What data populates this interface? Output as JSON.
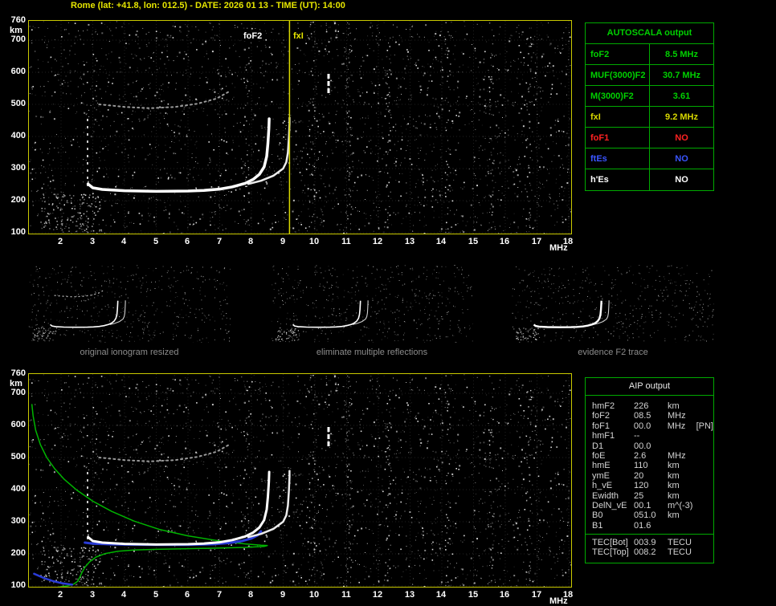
{
  "title": "Rome (lat: +41.8, lon: 012.5) - DATE: 2026 01 13 - TIME (UT): 14:00",
  "colors": {
    "title_yellow": "#e6e600",
    "plot_border": "#c9c900",
    "table_border": "#00aa00",
    "table_green": "#00d000",
    "value_yellow": "#d8d800",
    "value_red": "#ff2222",
    "value_blue": "#3a55ff",
    "value_white": "#ffffff",
    "profile_green": "#00b400",
    "fit_blue": "#2a3cd8",
    "caption_gray": "#8c8c8c"
  },
  "plots": {
    "x_unit": "MHz",
    "y_unit": "km",
    "x_ticks": [
      2,
      3,
      4,
      5,
      6,
      7,
      8,
      9,
      10,
      11,
      12,
      13,
      14,
      15,
      16,
      17,
      18
    ],
    "y_ticks": [
      760,
      700,
      600,
      500,
      400,
      300,
      200,
      100
    ],
    "top": {
      "fof2_label": "foF2",
      "fxi_label": "fxI",
      "fxi_freq": 9.2,
      "o_trace": [
        [
          2.85,
          252
        ],
        [
          3.0,
          240
        ],
        [
          3.3,
          235
        ],
        [
          4,
          231
        ],
        [
          5,
          229
        ],
        [
          6,
          230
        ],
        [
          6.5,
          232
        ],
        [
          7,
          236
        ],
        [
          7.4,
          243
        ],
        [
          7.8,
          254
        ],
        [
          8.05,
          266
        ],
        [
          8.25,
          282
        ],
        [
          8.4,
          305
        ],
        [
          8.48,
          338
        ],
        [
          8.52,
          378
        ],
        [
          8.55,
          425
        ],
        [
          8.56,
          455
        ]
      ],
      "x_trace": [
        [
          7.9,
          252
        ],
        [
          8.3,
          262
        ],
        [
          8.7,
          278
        ],
        [
          9.0,
          300
        ],
        [
          9.1,
          320
        ],
        [
          9.15,
          350
        ],
        [
          9.18,
          395
        ],
        [
          9.2,
          440
        ],
        [
          9.2,
          458
        ]
      ],
      "multiple_trace": [
        [
          3.2,
          500
        ],
        [
          4,
          492
        ],
        [
          4.8,
          488
        ],
        [
          5.6,
          492
        ],
        [
          6.3,
          502
        ],
        [
          6.9,
          518
        ],
        [
          7.3,
          540
        ]
      ]
    },
    "bottom": {
      "profile": [
        [
          1.08,
          665
        ],
        [
          1.12,
          630
        ],
        [
          1.2,
          585
        ],
        [
          1.35,
          540
        ],
        [
          1.55,
          500
        ],
        [
          1.8,
          465
        ],
        [
          2.1,
          432
        ],
        [
          2.5,
          398
        ],
        [
          3.0,
          364
        ],
        [
          3.6,
          332
        ],
        [
          4.3,
          302
        ],
        [
          5.1,
          276
        ],
        [
          6.0,
          256
        ],
        [
          7.0,
          240
        ],
        [
          7.8,
          231
        ],
        [
          8.3,
          227
        ],
        [
          8.5,
          226
        ],
        [
          8.4,
          223
        ],
        [
          7.8,
          220
        ],
        [
          7.0,
          218
        ],
        [
          6.0,
          216
        ],
        [
          5.0,
          214
        ],
        [
          4.3,
          212
        ],
        [
          3.8,
          208
        ],
        [
          3.4,
          201
        ],
        [
          3.1,
          190
        ],
        [
          2.9,
          175
        ],
        [
          2.75,
          158
        ],
        [
          2.65,
          140
        ],
        [
          2.58,
          125
        ],
        [
          2.52,
          114
        ],
        [
          2.4,
          106
        ],
        [
          2.2,
          100
        ],
        [
          1.9,
          96
        ],
        [
          1.6,
          94
        ],
        [
          1.3,
          93
        ]
      ],
      "fit_trace": [
        [
          2.75,
          235
        ],
        [
          3.0,
          232
        ],
        [
          3.5,
          230
        ],
        [
          4.0,
          229
        ],
        [
          5.0,
          228
        ],
        [
          6.0,
          228
        ],
        [
          6.8,
          230
        ],
        [
          7.3,
          234
        ],
        [
          7.7,
          240
        ],
        [
          8.0,
          248
        ],
        [
          8.2,
          258
        ],
        [
          8.3,
          270
        ]
      ],
      "e_trace": [
        [
          1.15,
          138
        ],
        [
          1.45,
          125
        ],
        [
          1.75,
          115
        ],
        [
          2.05,
          108
        ],
        [
          2.35,
          104
        ]
      ]
    }
  },
  "autoscala_table": {
    "title": "AUTOSCALA output",
    "rows": [
      {
        "label": "foF2",
        "value": "8.5 MHz",
        "color": "#00d000"
      },
      {
        "label": "MUF(3000)F2",
        "value": "30.7 MHz",
        "color": "#00d000"
      },
      {
        "label": "M(3000)F2",
        "value": "3.61",
        "color": "#00d000"
      },
      {
        "label": "fxI",
        "value": "9.2 MHz",
        "color": "#d8d800"
      },
      {
        "label": "foF1",
        "value": "NO",
        "color": "#ff2222"
      },
      {
        "label": "ftEs",
        "value": "NO",
        "color": "#3a55ff"
      },
      {
        "label": "h'Es",
        "value": "NO",
        "color": "#ffffff"
      }
    ]
  },
  "thumbnails": [
    {
      "caption": "original ionogram resized"
    },
    {
      "caption": "eliminate multiple reflections"
    },
    {
      "caption": "evidence F2 trace"
    }
  ],
  "aip_table": {
    "title": "AIP output",
    "rows": [
      {
        "label": "hmF2",
        "value": "226",
        "unit": "km",
        "extra": ""
      },
      {
        "label": "foF2",
        "value": "08.5",
        "unit": "MHz",
        "extra": ""
      },
      {
        "label": "foF1",
        "value": "00.0",
        "unit": "MHz",
        "extra": "[PN]"
      },
      {
        "label": "hmF1",
        "value": "--",
        "unit": "",
        "extra": ""
      },
      {
        "label": "D1",
        "value": "00.0",
        "unit": "",
        "extra": ""
      },
      {
        "label": "foE",
        "value": "2.6",
        "unit": "MHz",
        "extra": ""
      },
      {
        "label": "hmE",
        "value": "110",
        "unit": "km",
        "extra": ""
      },
      {
        "label": "ymE",
        "value": "20",
        "unit": "km",
        "extra": ""
      },
      {
        "label": "h_vE",
        "value": "120",
        "unit": "km",
        "extra": ""
      },
      {
        "label": "Ewidth",
        "value": "25",
        "unit": "km",
        "extra": ""
      },
      {
        "label": "DelN_vE",
        "value": "00.1",
        "unit": "m^(-3)",
        "extra": ""
      },
      {
        "label": "B0",
        "value": "051.0",
        "unit": "km",
        "extra": ""
      },
      {
        "label": "B1",
        "value": "01.6",
        "unit": "",
        "extra": ""
      }
    ],
    "tec_rows": [
      {
        "label": "TEC[Bot]",
        "value": "003.9",
        "unit": "TECU"
      },
      {
        "label": "TEC[Top]",
        "value": "008.2",
        "unit": "TECU"
      }
    ]
  }
}
